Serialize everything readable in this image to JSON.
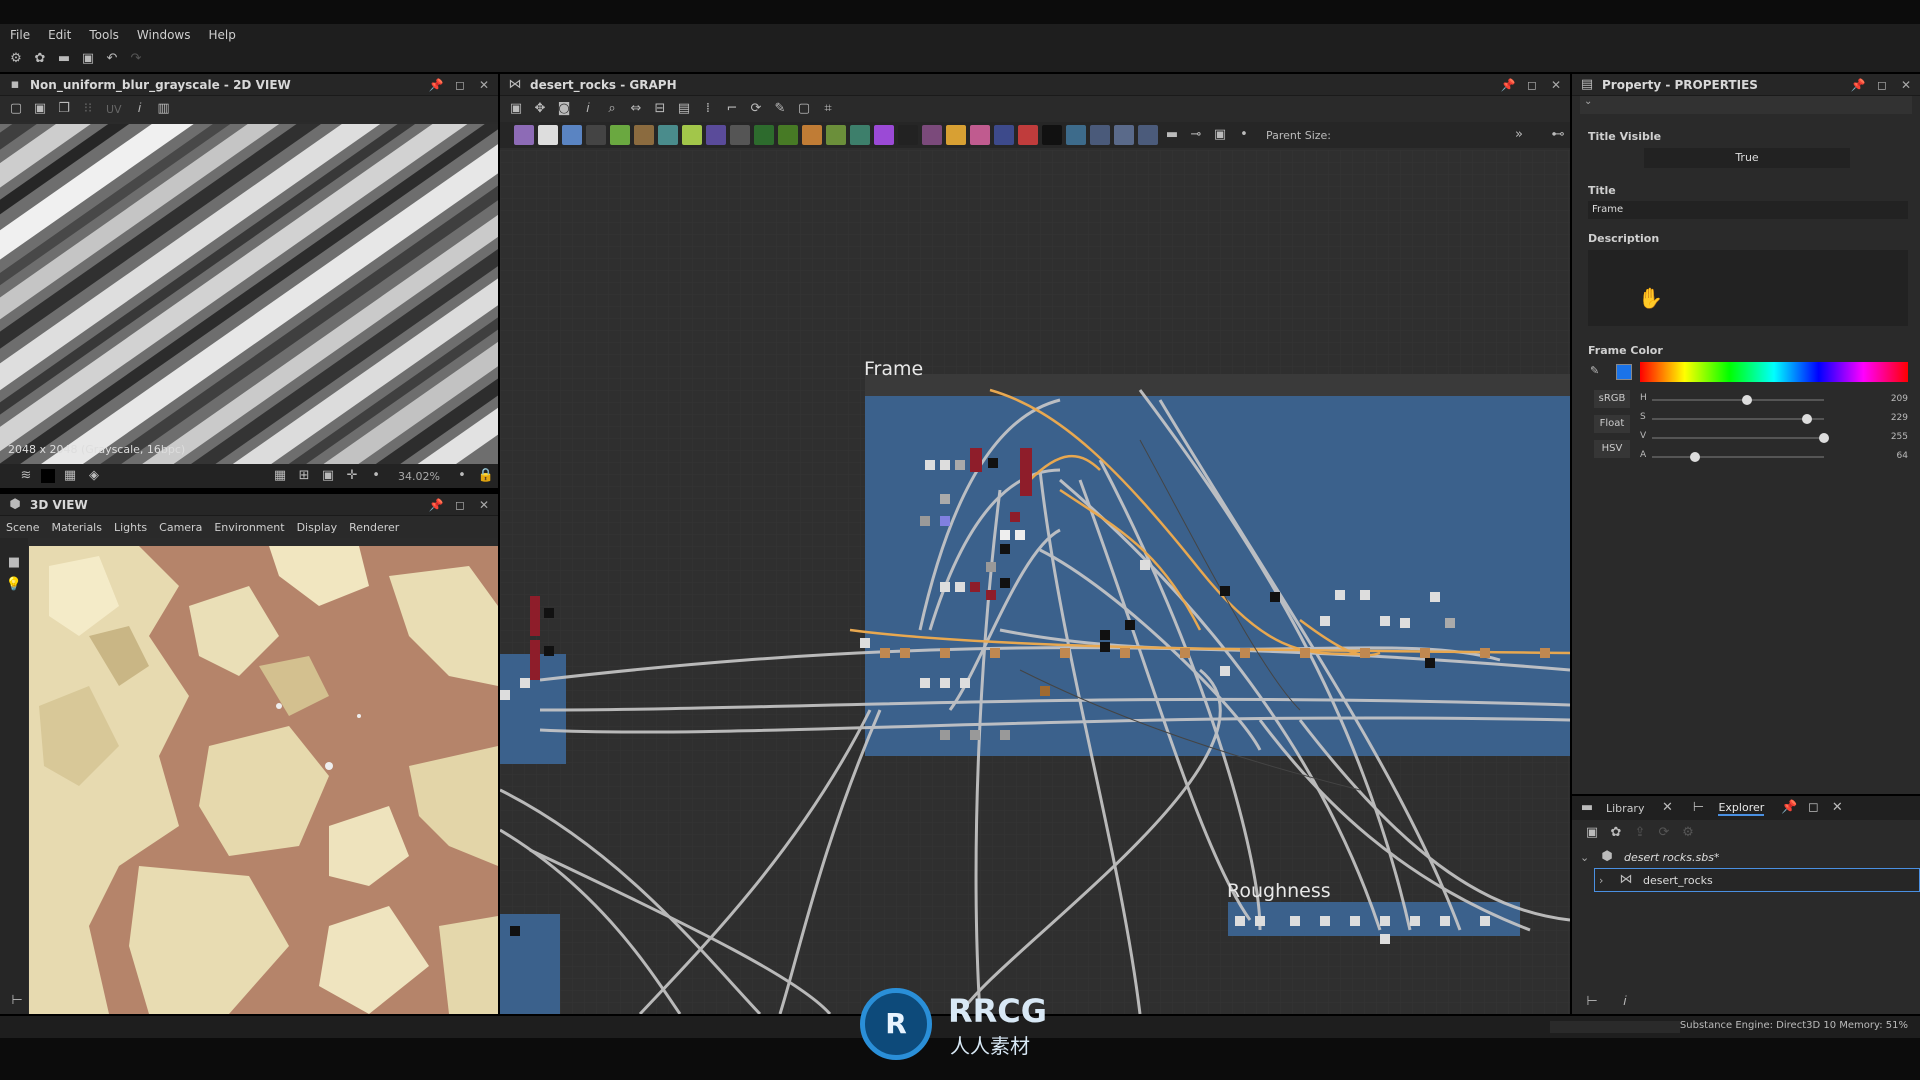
{
  "menu": [
    "File",
    "Edit",
    "Tools",
    "Windows",
    "Help"
  ],
  "view2d": {
    "title": "Non_uniform_blur_grayscale - 2D VIEW",
    "uv_label": "UV",
    "info": "2048 x 2048 (Grayscale, 16bpc)",
    "zoom": "34.02%"
  },
  "view3d": {
    "title": "3D VIEW",
    "menu": [
      "Scene",
      "Materials",
      "Lights",
      "Camera",
      "Environment",
      "Display",
      "Renderer"
    ]
  },
  "graph": {
    "title": "desert_rocks - GRAPH",
    "parent_size_label": "Parent Size:",
    "frame_title": "Frame",
    "roughness_title": "Roughness"
  },
  "properties": {
    "title": "Property - PROPERTIES",
    "title_visible_label": "Title Visible",
    "title_visible_value": "True",
    "title_label": "Title",
    "title_value": "Frame",
    "description_label": "Description",
    "frame_color_label": "Frame Color",
    "frame_color": "#1a73e8",
    "mode_buttons": [
      "sRGB",
      "Float",
      "HSV"
    ],
    "sliders": [
      {
        "label": "H",
        "value": "209",
        "fraction": 0.55
      },
      {
        "label": "S",
        "value": "229",
        "fraction": 0.9
      },
      {
        "label": "V",
        "value": "255",
        "fraction": 1.0
      },
      {
        "label": "A",
        "value": "64",
        "fraction": 0.25
      }
    ]
  },
  "explorer": {
    "tabs": [
      "Library",
      "Explorer"
    ],
    "package": "desert rocks.sbs*",
    "graph_item": "desert_rocks"
  },
  "status": {
    "engine": "Substance Engine: Direct3D 10  Memory: 51%"
  },
  "watermark": {
    "main": "RRCG",
    "sub": "人人素材"
  }
}
